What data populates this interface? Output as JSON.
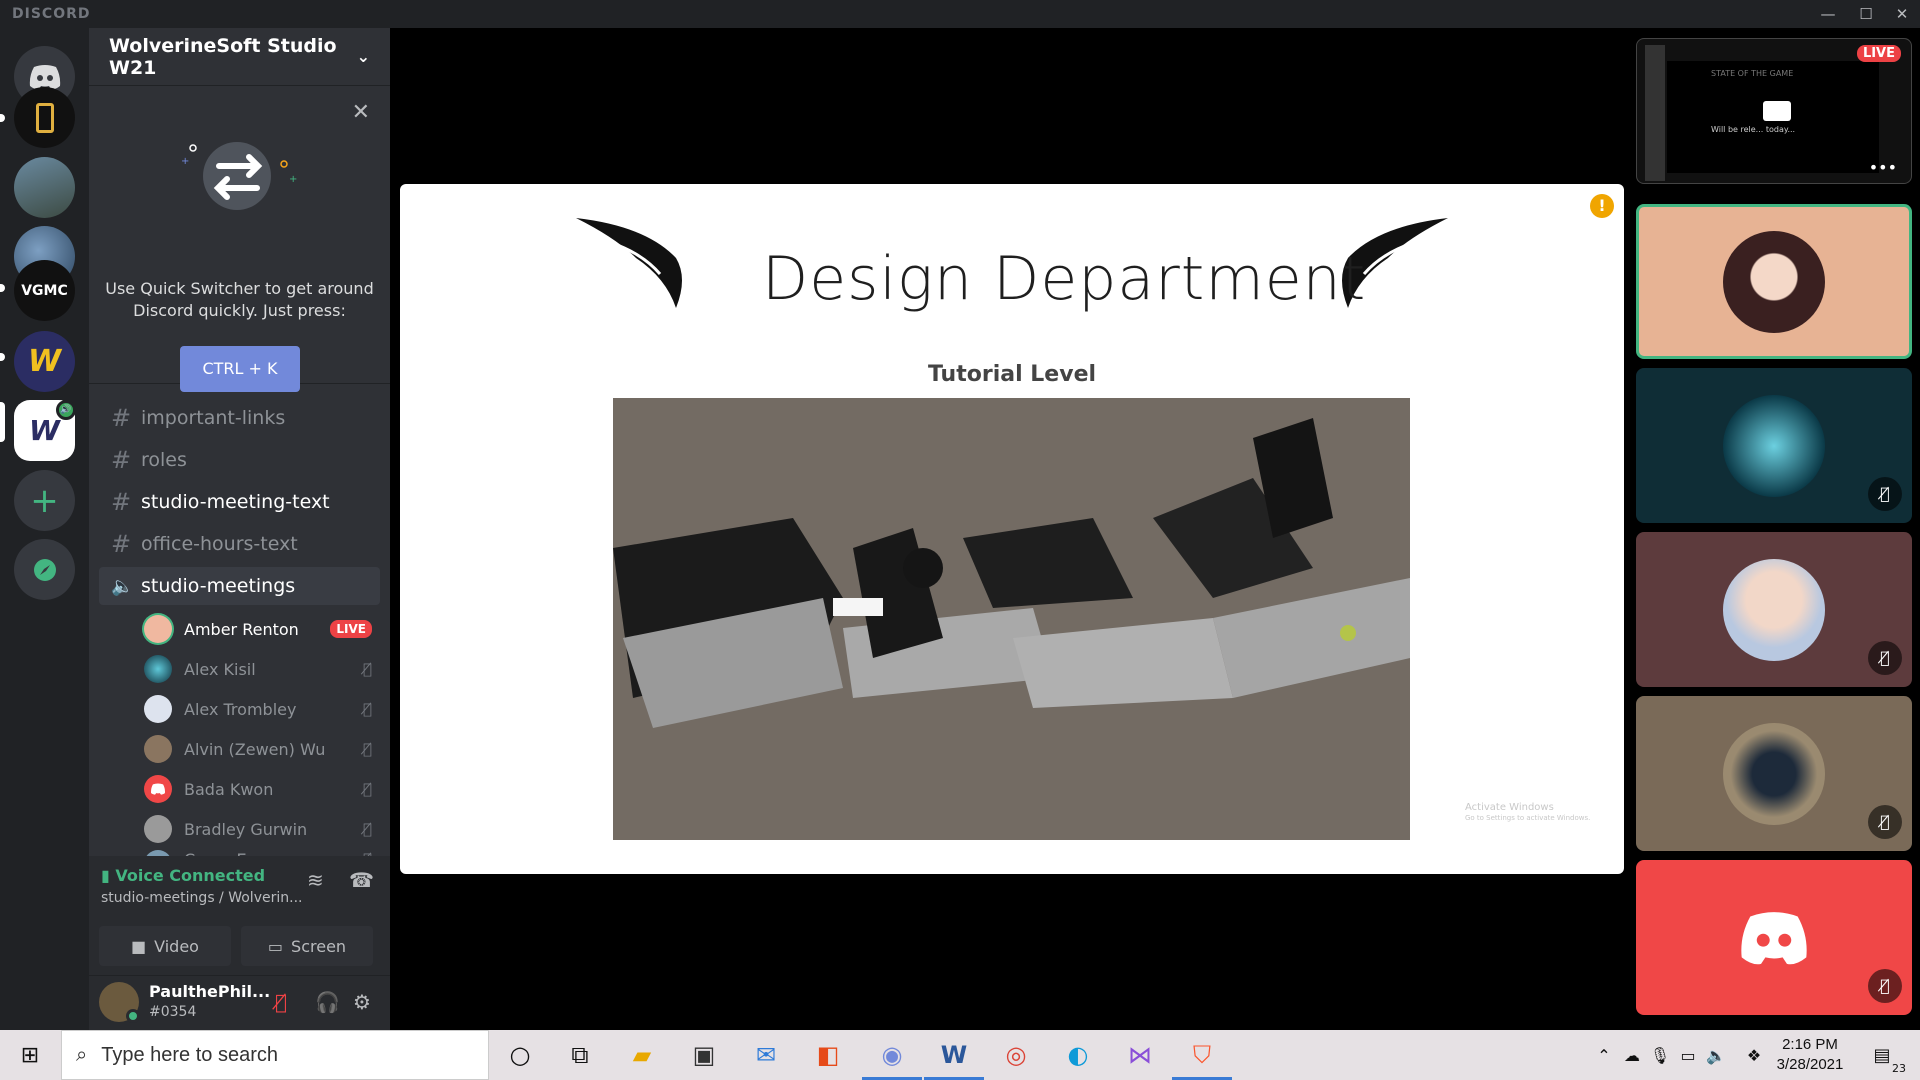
{
  "titlebar": {
    "brand": "DISCORD"
  },
  "server": {
    "name": "WolverineSoft Studio W21"
  },
  "quick_switcher": {
    "tip": "Use Quick Switcher to get around Discord quickly. Just press:",
    "shortcut": "CTRL + K"
  },
  "channels": [
    {
      "type": "text",
      "name": "important-links",
      "state": "read"
    },
    {
      "type": "text",
      "name": "roles",
      "state": "read"
    },
    {
      "type": "text",
      "name": "studio-meeting-text",
      "state": "unread"
    },
    {
      "type": "text",
      "name": "office-hours-text",
      "state": "read"
    },
    {
      "type": "voice",
      "name": "studio-meetings",
      "state": "active"
    }
  ],
  "voice_members": [
    {
      "name": "Amber Renton",
      "live": "LIVE",
      "speaking": true
    },
    {
      "name": "Alex Kisil",
      "muted": true
    },
    {
      "name": "Alex Trombley",
      "muted": true
    },
    {
      "name": "Alvin (Zewen) Wu",
      "muted": true
    },
    {
      "name": "Bada Kwon",
      "muted": true
    },
    {
      "name": "Bradley Gurwin",
      "muted": true
    },
    {
      "name": "Conor Egan",
      "muted": true
    }
  ],
  "voice_panel": {
    "status": "Voice Connected",
    "location": "studio-meetings / Wolverin...",
    "video_label": "Video",
    "screen_label": "Screen"
  },
  "user": {
    "name": "PaulthePhil...",
    "tag": "#0354"
  },
  "slide": {
    "title": "Design Department",
    "subtitle": "Tutorial Level",
    "watermark_line1": "Activate Windows",
    "watermark_line2": "Go to Settings to activate Windows."
  },
  "stream_preview": {
    "badge": "LIVE",
    "line1": "STATE OF THE GAME",
    "line2": "Will be rele... today..."
  },
  "taskbar": {
    "search_placeholder": "Type here to search",
    "time": "2:16 PM",
    "date": "3/28/2021",
    "notifications": "23"
  },
  "colors": {
    "blurple": "#7289da",
    "online": "#43b581",
    "live_red": "#ed4245",
    "tile_active": "#e7b394",
    "tile_teal": "#0f2d36",
    "tile_maroon": "#5d3b3d",
    "tile_brown": "#7a6a58",
    "tile_red": "#f04747"
  }
}
